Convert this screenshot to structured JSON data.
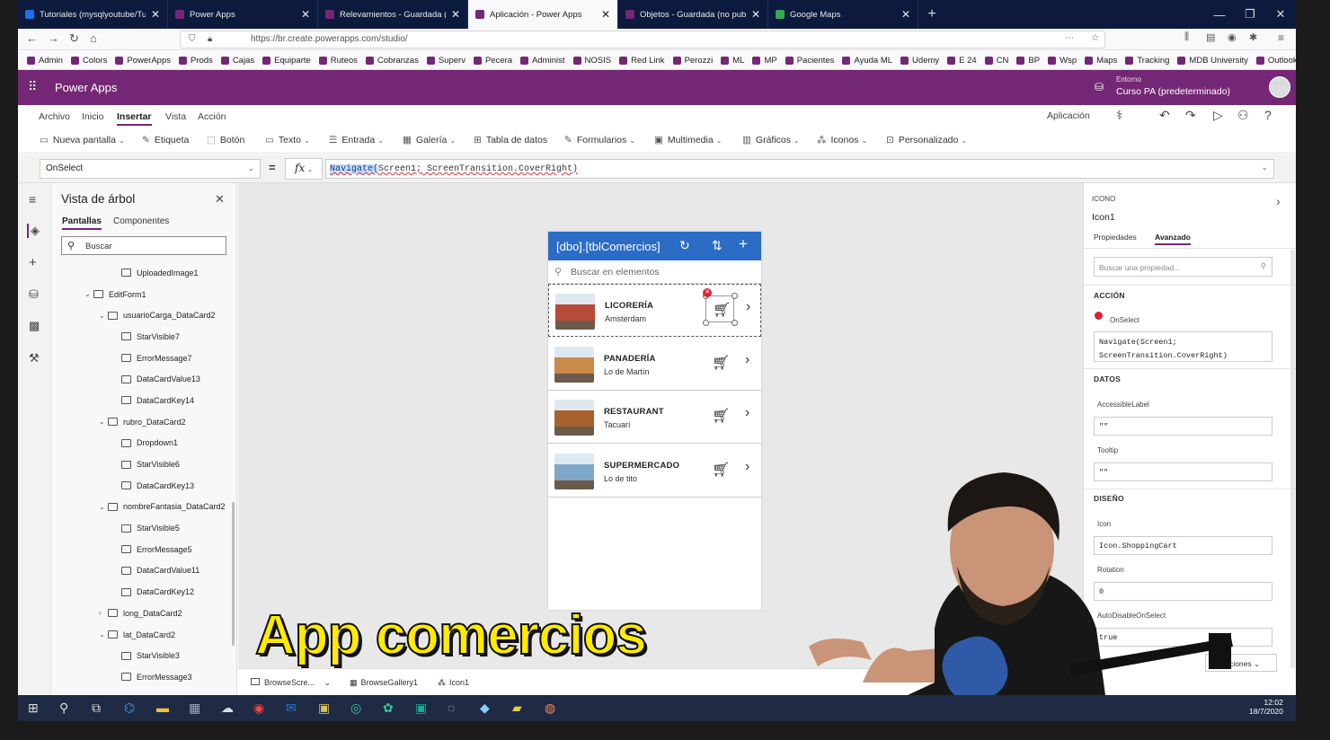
{
  "browser": {
    "tabs": [
      {
        "label": "Tutoriales (mysqlyoutube/Tuto",
        "fav": "azure-icon",
        "active": false
      },
      {
        "label": "Power Apps",
        "fav": "powerapps-icon",
        "active": false
      },
      {
        "label": "Relevamientos - Guardada (no",
        "fav": "powerapps-icon",
        "active": false
      },
      {
        "label": "Aplicación - Power Apps",
        "fav": "powerapps-icon",
        "active": true
      },
      {
        "label": "Objetos - Guardada (no public",
        "fav": "powerapps-icon",
        "active": false
      },
      {
        "label": "Google Maps",
        "fav": "maps-icon",
        "active": false
      }
    ],
    "url": "https://br.create.powerapps.com/studio/",
    "bookmarks": [
      "Admin",
      "Colors",
      "PowerApps",
      "Prods",
      "Cajas",
      "Equiparte",
      "Ruteos",
      "Cobranzas",
      "Superv",
      "Pecera",
      "Administ",
      "NOSIS",
      "Red Link",
      "Perozzi",
      "ML",
      "MP",
      "Pacientes",
      "Ayuda ML",
      "Udemy",
      "E 24",
      "CN",
      "BP",
      "Wsp",
      "Maps",
      "Tracking",
      "MDB University",
      "Outlook"
    ]
  },
  "header": {
    "app_title": "Power Apps",
    "env_label": "Entorno",
    "env_name": "Curso PA (predeterminado)"
  },
  "menu": {
    "items": [
      "Archivo",
      "Inicio",
      "Insertar",
      "Vista",
      "Acción"
    ],
    "active": "Insertar",
    "app_label": "Aplicación"
  },
  "ribbon": [
    "Nueva pantalla",
    "Etiqueta",
    "Botón",
    "Texto",
    "Entrada",
    "Galería",
    "Tabla de datos",
    "Formularios",
    "Multimedia",
    "Gráficos",
    "Iconos",
    "Personalizado"
  ],
  "formula": {
    "property": "OnSelect",
    "fx": "fx",
    "func": "Navigate(",
    "rest": "Screen1; ScreenTransition.CoverRight)"
  },
  "tree": {
    "title": "Vista de árbol",
    "tabs": [
      "Pantallas",
      "Componentes"
    ],
    "search_placeholder": "Buscar",
    "nodes": [
      {
        "label": "UploadedImage1",
        "level": 2
      },
      {
        "label": "EditForm1",
        "level": 0
      },
      {
        "label": "usuarioCarga_DataCard2",
        "level": 1
      },
      {
        "label": "StarVisible7",
        "level": 2
      },
      {
        "label": "ErrorMessage7",
        "level": 2
      },
      {
        "label": "DataCardValue13",
        "level": 2
      },
      {
        "label": "DataCardKey14",
        "level": 2
      },
      {
        "label": "rubro_DataCard2",
        "level": 1
      },
      {
        "label": "Dropdown1",
        "level": 2
      },
      {
        "label": "StarVisible6",
        "level": 2
      },
      {
        "label": "DataCardKey13",
        "level": 2
      },
      {
        "label": "nombreFantasia_DataCard2",
        "level": 1
      },
      {
        "label": "StarVisible5",
        "level": 2
      },
      {
        "label": "ErrorMessage5",
        "level": 2
      },
      {
        "label": "DataCardValue11",
        "level": 2
      },
      {
        "label": "DataCardKey12",
        "level": 2
      },
      {
        "label": "long_DataCard2",
        "level": 1
      },
      {
        "label": "lat_DataCard2",
        "level": 1
      },
      {
        "label": "StarVisible3",
        "level": 2
      },
      {
        "label": "ErrorMessage3",
        "level": 2
      }
    ]
  },
  "gallery": {
    "title": "[dbo].[tblComercios]",
    "search_placeholder": "Buscar en elementos",
    "rows": [
      {
        "name": "LICORERÍA",
        "sub": "Amsterdam",
        "color": "#b84a3a"
      },
      {
        "name": "PANADERÍA",
        "sub": "Lo de Martín",
        "color": "#c98a4a"
      },
      {
        "name": "RESTAURANT",
        "sub": "Tacuarí",
        "color": "#a8612c"
      },
      {
        "name": "SUPERMERCADO",
        "sub": "Lo de tito",
        "color": "#7fa7c9"
      }
    ]
  },
  "statusbar": {
    "screen": "BrowseScre...",
    "gallery": "BrowseGallery1",
    "icon": "Icon1"
  },
  "props": {
    "type_label": "ICONO",
    "name": "Icon1",
    "tabs": [
      "Propiedades",
      "Avanzado"
    ],
    "search_placeholder": "Buscar una propiedad...",
    "sec_action": "ACCIÓN",
    "onselect_label": "OnSelect",
    "onselect_value_1": "Navigate(Screen1;",
    "onselect_value_2": "ScreenTransition.CoverRight)",
    "sec_data": "DATOS",
    "accessible_label": "AccessibleLabel",
    "accessible_value": "\"\"",
    "tooltip_label": "Tooltip",
    "tooltip_value": "\"\"",
    "sec_design": "DISEÑO",
    "icon_label": "Icon",
    "icon_value": "Icon.ShoppingCart",
    "rotation_label": "Rotation",
    "rotation_value": "0",
    "autodisable_label": "AutoDisableOnSelect",
    "autodisable_value": "true",
    "more_options": "s opciones"
  },
  "taskbar": {
    "time": "12:02",
    "date": "18/7/2020"
  },
  "overlay_title": "App comercios"
}
